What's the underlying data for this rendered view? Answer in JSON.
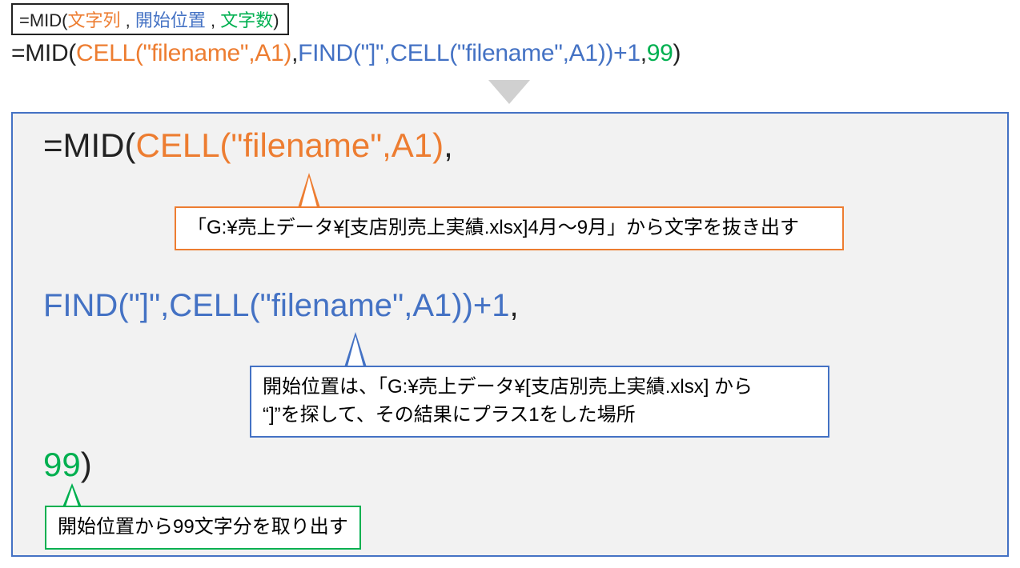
{
  "syntax": {
    "prefix": "=MID(",
    "arg1": "文字列",
    "sep": " , ",
    "arg2": "開始位置",
    "arg3": "文字数",
    "suffix": ")"
  },
  "main_formula": {
    "p1": "=MID(",
    "p2": "CELL(\"filename\",A1)",
    "p3": ",",
    "p4": "FIND(\"]\",CELL(\"filename\",A1))+1",
    "p5": ",",
    "p6": "99",
    "p7": ")"
  },
  "panel": {
    "line1": {
      "a": "=MID(",
      "b": "CELL(\"filename\",A1)",
      "c": ","
    },
    "line2": {
      "a": "FIND(\"]\",CELL(\"filename\",A1))+1",
      "b": ","
    },
    "line3": {
      "a": "99",
      "b": ")"
    },
    "callout1": "「G:¥売上データ¥[支店別売上実績.xlsx]4月～9月」から文字を抜き出す",
    "callout2_l1": "開始位置は、「G:¥売上データ¥[支店別売上実績.xlsx] から",
    "callout2_l2": "“]”を探して、その結果にプラス1をした場所",
    "callout3": "開始位置から99文字分を取り出す"
  }
}
